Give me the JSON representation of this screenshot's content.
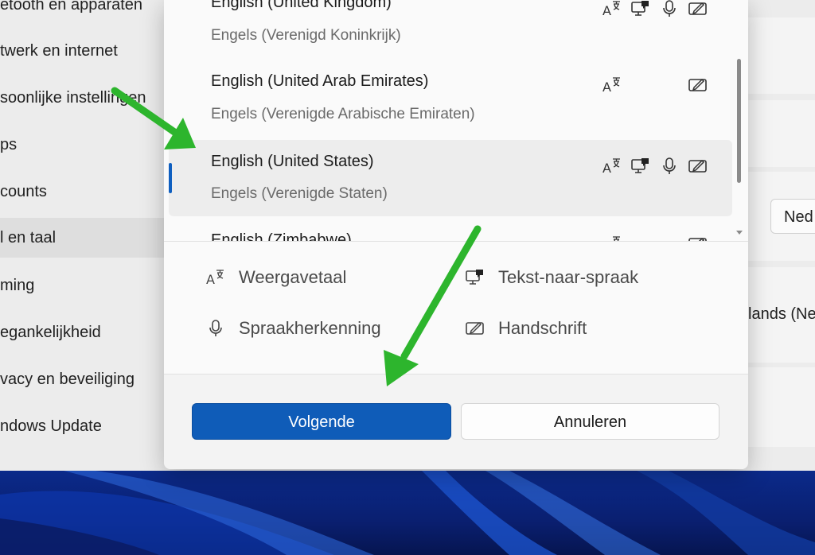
{
  "background": {
    "nav_items": [
      {
        "label": "etooth en apparaten"
      },
      {
        "label": "twerk en internet"
      },
      {
        "label": "soonlijke instellingen"
      },
      {
        "label": "ps"
      },
      {
        "label": "counts"
      },
      {
        "label": "l en taal"
      },
      {
        "label": "ming"
      },
      {
        "label": "egankelijkheid"
      },
      {
        "label": "vacy en beveiliging"
      },
      {
        "label": "ndows Update"
      }
    ],
    "right_button": "Ned",
    "right_text": "lands (Ne"
  },
  "dialog": {
    "languages": [
      {
        "name": "English (United Kingdom)",
        "native": "Engels (Verenigd Koninkrijk)"
      },
      {
        "name": "English (United Arab Emirates)",
        "native": "Engels (Verenigde Arabische Emiraten)"
      },
      {
        "name": "English (United States)",
        "native": "Engels (Verenigde Staten)"
      },
      {
        "name": "English (Zimbabwe)"
      }
    ],
    "legend": {
      "display_language": "Weergavetaal",
      "text_to_speech": "Tekst-naar-spraak",
      "speech_recognition": "Spraakherkenning",
      "handwriting": "Handschrift"
    },
    "buttons": {
      "next": "Volgende",
      "cancel": "Annuleren"
    }
  },
  "colors": {
    "accent": "#0f5cb8",
    "annotation_arrow": "#2db52d"
  },
  "icons": [
    "display-language-icon",
    "text-to-speech-icon",
    "microphone-icon",
    "handwriting-icon"
  ]
}
